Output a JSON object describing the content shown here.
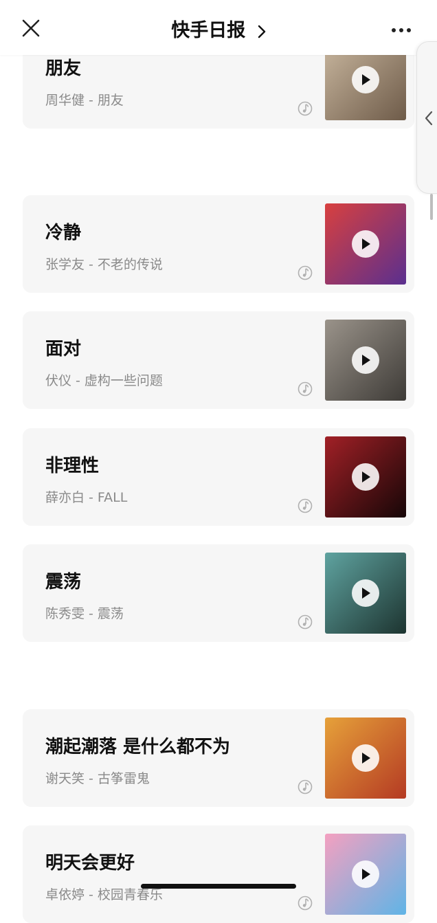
{
  "header": {
    "title": "快手日报"
  },
  "songs": [
    {
      "title": "朋友",
      "subtitle": "周华健 - 朋友",
      "cover_colors": [
        "#c9b79f",
        "#6e5b49"
      ]
    },
    {
      "title": "冷静",
      "subtitle": "张学友 - 不老的传说",
      "cover_colors": [
        "#d8403f",
        "#5a2f8f"
      ]
    },
    {
      "title": "面对",
      "subtitle": "伏仪 - 虚构一些问题",
      "cover_colors": [
        "#9a938a",
        "#3e3b37"
      ]
    },
    {
      "title": "非理性",
      "subtitle": "薛亦白 - FALL",
      "cover_colors": [
        "#a12026",
        "#160607"
      ]
    },
    {
      "title": "震荡",
      "subtitle": "陈秀雯 - 震荡",
      "cover_colors": [
        "#5fa3a0",
        "#1d3430"
      ]
    },
    {
      "title": "潮起潮落 是什么都不为",
      "subtitle": "谢天笑 - 古筝雷鬼",
      "cover_colors": [
        "#e6a13a",
        "#b43a23"
      ]
    },
    {
      "title": "明天会更好",
      "subtitle": "卓依婷 - 校园青春乐",
      "cover_colors": [
        "#f4a0c0",
        "#5fb4e6"
      ]
    }
  ]
}
